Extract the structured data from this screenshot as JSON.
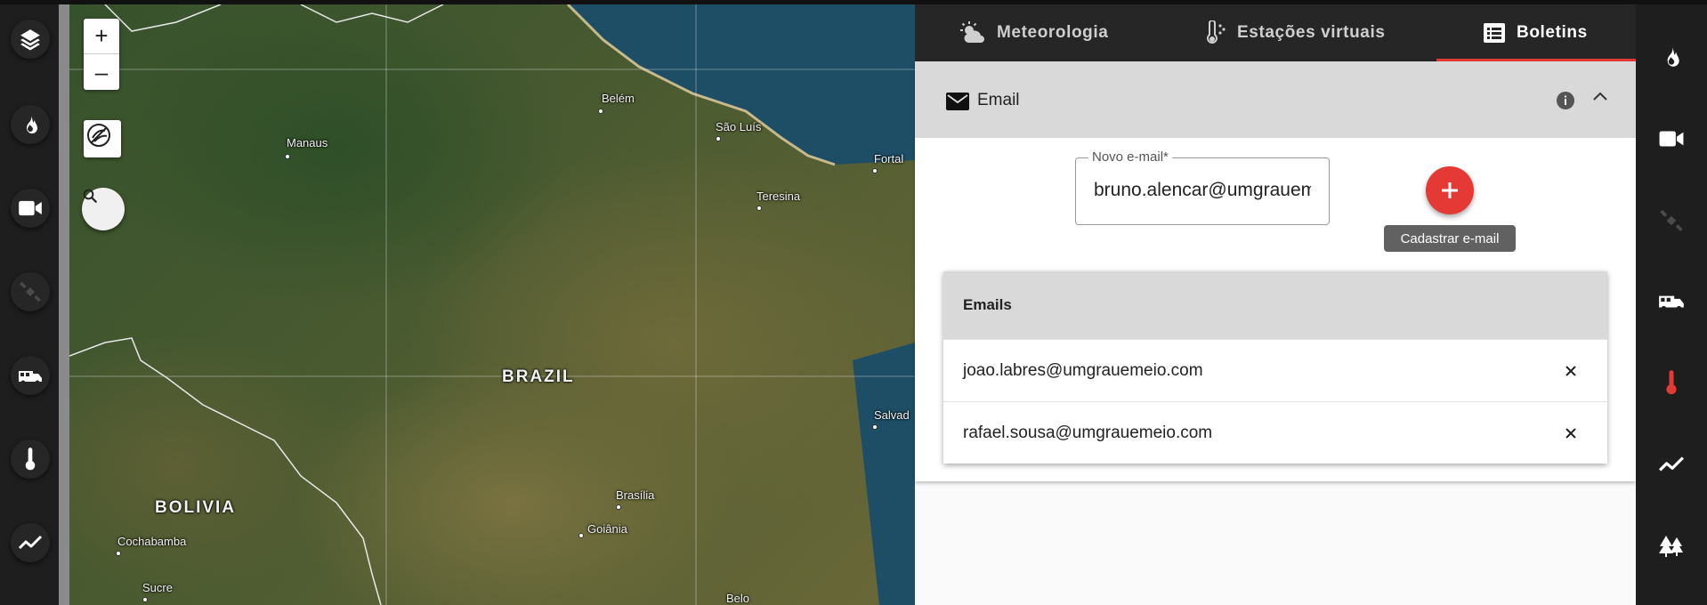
{
  "map": {
    "zoom_in": "+",
    "zoom_out": "–",
    "labels": {
      "belem": "Belém",
      "sao_luis": "São Luís",
      "manaus": "Manaus",
      "fortaleza": "Fortal",
      "teresina": "Teresina",
      "brazil": "BRAZIL",
      "salvador": "Salvad",
      "bolivia": "BOLIVIA",
      "brasilia": "Brasília",
      "goiania": "Goiânia",
      "cochabamba": "Cochabamba",
      "sucre": "Sucre",
      "belo": "Belo"
    }
  },
  "tabs": [
    {
      "label": "Meteorologia",
      "icon": "weather-icon"
    },
    {
      "label": "Estações virtuais",
      "icon": "thermometer-station-icon"
    },
    {
      "label": "Boletins",
      "icon": "list-icon"
    }
  ],
  "email_section": {
    "title": "Email",
    "field_label": "Novo e-mail*",
    "field_value": "bruno.alencar@umgrauemeio.com",
    "add_tooltip": "Cadastrar e-mail",
    "table_header": "Emails",
    "rows": [
      {
        "email": "joao.labres@umgrauemeio.com"
      },
      {
        "email": "rafael.sousa@umgrauemeio.com"
      }
    ]
  },
  "colors": {
    "accent": "#e53935",
    "dark": "#1e1e1e"
  }
}
